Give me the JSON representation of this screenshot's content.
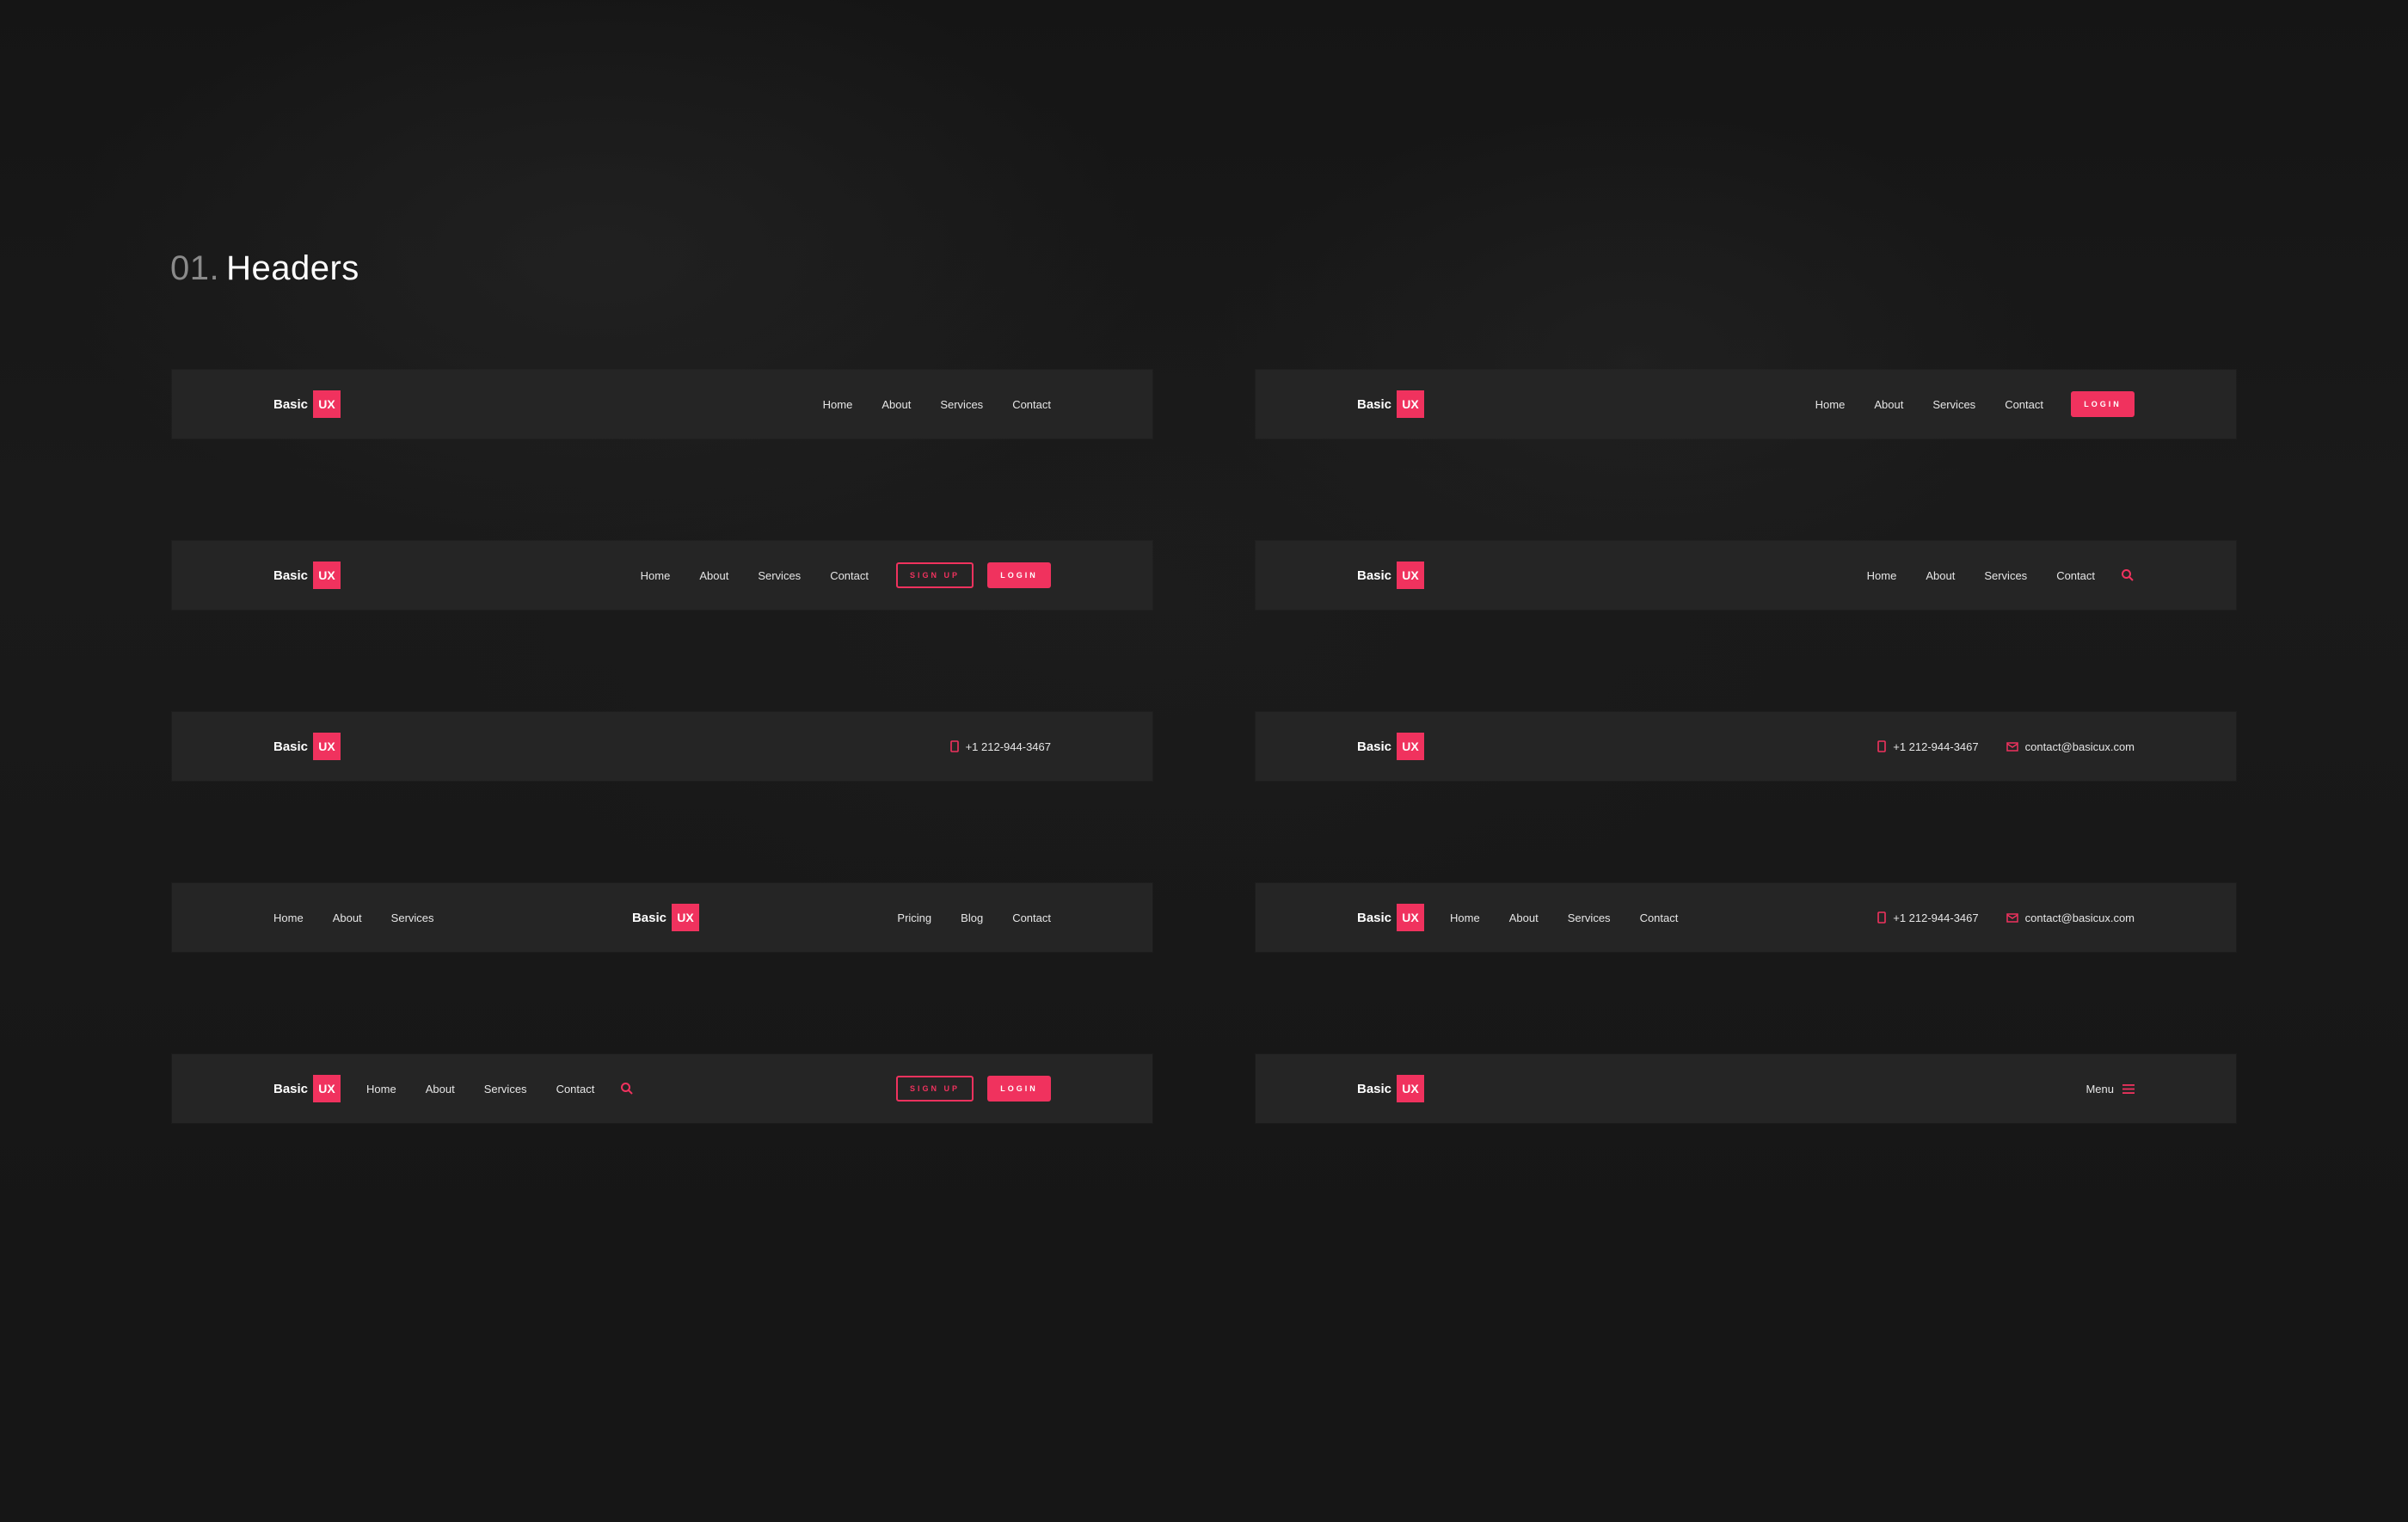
{
  "section": {
    "number": "01.",
    "title": "Headers"
  },
  "brand": {
    "name": "Basic",
    "badge": "UX"
  },
  "nav": {
    "home": "Home",
    "about": "About",
    "services": "Services",
    "contact": "Contact",
    "pricing": "Pricing",
    "blog": "Blog"
  },
  "buttons": {
    "login": "LOGIN",
    "signup": "SIGN UP"
  },
  "contact": {
    "phone": "+1 212-944-3467",
    "email": "contact@basicux.com"
  },
  "menu": {
    "label": "Menu"
  },
  "colors": {
    "accent": "#f0325e",
    "bar": "#252525",
    "background": "#161616"
  },
  "icons": [
    "search-icon",
    "phone-icon",
    "mail-icon",
    "hamburger-icon"
  ]
}
